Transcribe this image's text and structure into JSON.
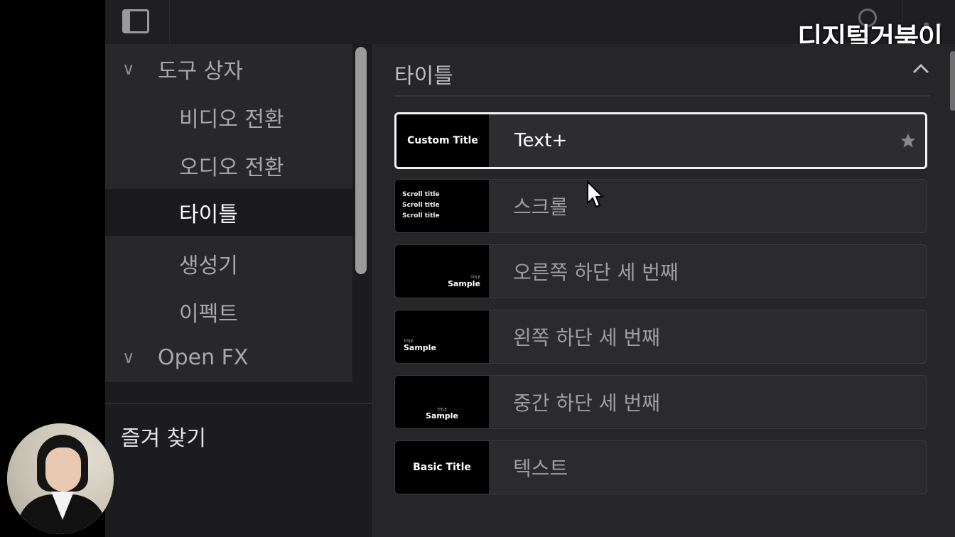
{
  "watermark": "디지털거북이",
  "topbar": {
    "panel_toggle_icon": "panel-toggle-icon",
    "search_icon": "search-icon",
    "more_icon": "more-options-icon",
    "more_glyph": "••"
  },
  "sidebar": {
    "tree": [
      {
        "label": "도구 상자",
        "type": "category",
        "expanded": true
      },
      {
        "label": "비디오 전환",
        "type": "sub"
      },
      {
        "label": "오디오 전환",
        "type": "sub"
      },
      {
        "label": "타이틀",
        "type": "sub",
        "selected": true
      },
      {
        "label": "생성기",
        "type": "sub"
      },
      {
        "label": "이펙트",
        "type": "sub"
      },
      {
        "label": "Open FX",
        "type": "category",
        "expanded": true
      }
    ],
    "chevron_glyph": "∨",
    "favorites_label": "즐겨 찾기"
  },
  "main": {
    "section_title": "타이틀",
    "items": [
      {
        "label": "Text+",
        "thumb_text": "Custom Title",
        "selected": true,
        "starred": true
      },
      {
        "label": "스크롤",
        "thumb_lines": [
          "Scroll title",
          "Scroll title",
          "Scroll title"
        ]
      },
      {
        "label": "오른쪽 하단 세 번째",
        "thumb_sample_small": "TITLE",
        "thumb_sample": "Sample"
      },
      {
        "label": "왼쪽 하단 세 번째",
        "thumb_sample_small": "TITLE",
        "thumb_sample": "Sample"
      },
      {
        "label": "중간 하단 세 번째",
        "thumb_sample_small": "TITLE",
        "thumb_sample": "Sample"
      },
      {
        "label": "텍스트",
        "thumb_text": "Basic Title"
      }
    ]
  },
  "colors": {
    "background": "#262628",
    "sidebar": "#28282a",
    "selected_border": "#f2f2f2",
    "text": "#bdbdbd"
  }
}
